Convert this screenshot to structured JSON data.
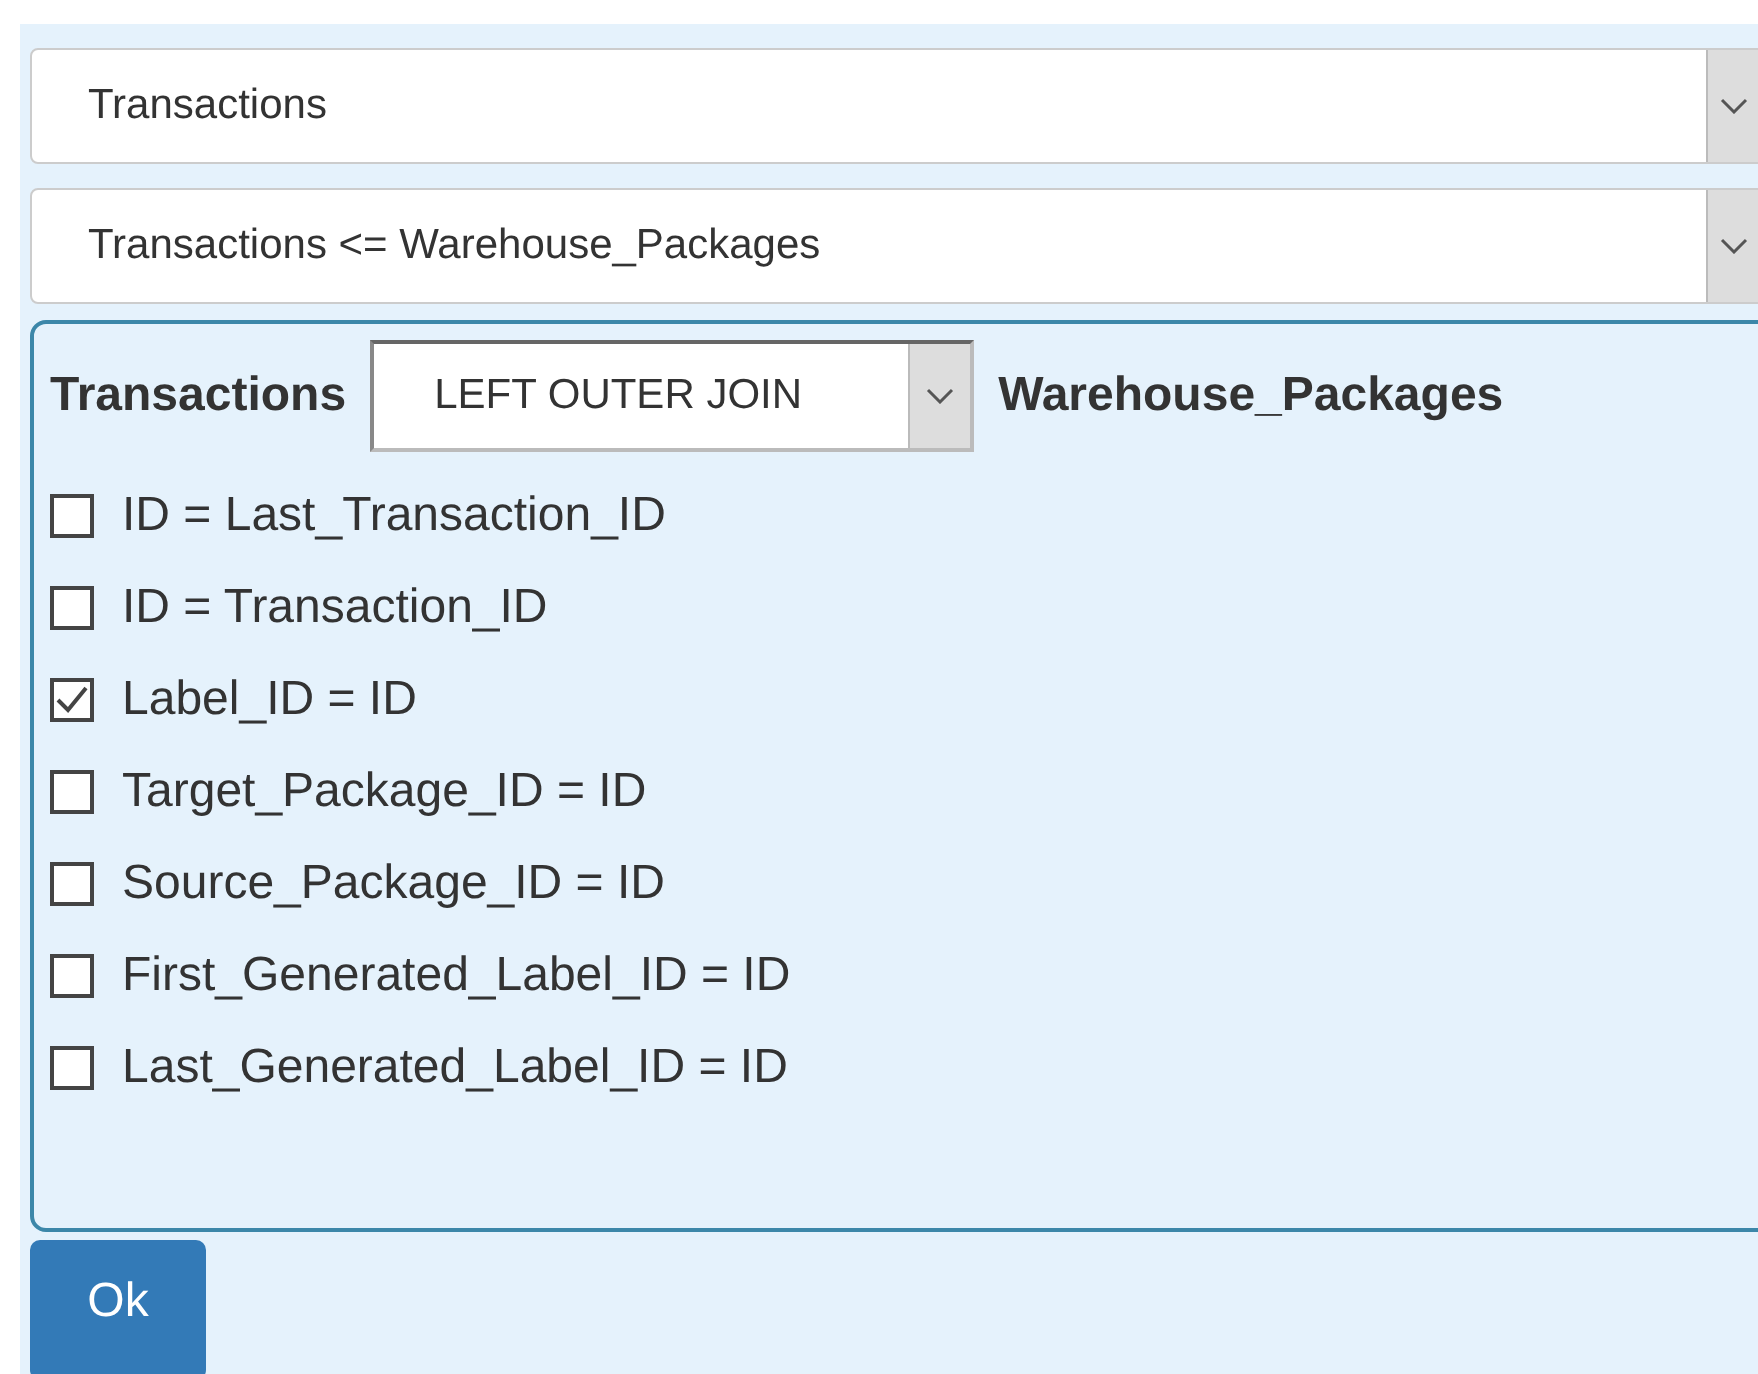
{
  "table_select": {
    "value": "Transactions"
  },
  "relation_select": {
    "value": "Transactions <= Warehouse_Packages"
  },
  "join": {
    "left_table": "Transactions",
    "join_type": "LEFT OUTER JOIN",
    "right_table": "Warehouse_Packages",
    "conditions": [
      {
        "label": "ID = Last_Transaction_ID",
        "checked": false
      },
      {
        "label": "ID = Transaction_ID",
        "checked": false
      },
      {
        "label": "Label_ID = ID",
        "checked": true
      },
      {
        "label": "Target_Package_ID = ID",
        "checked": false
      },
      {
        "label": "Source_Package_ID = ID",
        "checked": false
      },
      {
        "label": "First_Generated_Label_ID = ID",
        "checked": false
      },
      {
        "label": "Last_Generated_Label_ID = ID",
        "checked": false
      }
    ]
  },
  "buttons": [
    "Ok"
  ]
}
